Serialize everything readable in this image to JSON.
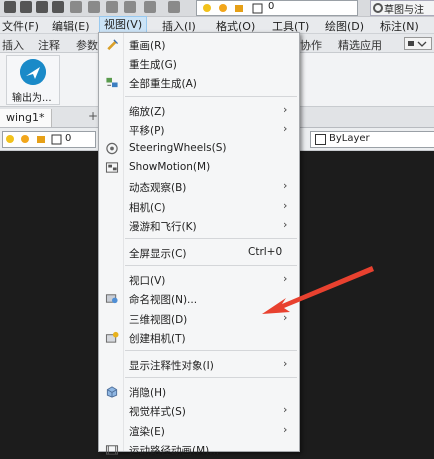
{
  "quick_access": {
    "layer_value": "0",
    "workspace_label": "草图与注"
  },
  "menubar": {
    "items": [
      "文件(F)",
      "编辑(E)",
      "视图(V)",
      "插入(I)",
      "格式(O)",
      "工具(T)",
      "绘图(D)",
      "标注(N)"
    ]
  },
  "ribbon_tabs": {
    "items": [
      "插入",
      "注释",
      "参数",
      "协作",
      "精选应用"
    ]
  },
  "ribbon": {
    "export_label": "输出为..."
  },
  "file_tabs": {
    "drawing_tab": "wing1*",
    "new_tab": "+"
  },
  "properties": {
    "layer_value": "0",
    "linetype": "ByLayer"
  },
  "view_menu": {
    "groups": [
      [
        {
          "label": "重画(R)",
          "icon": "redraw-icon",
          "submenu": false
        },
        {
          "label": "重生成(G)",
          "icon": "",
          "submenu": false
        },
        {
          "label": "全部重生成(A)",
          "icon": "regen-all-icon",
          "submenu": false
        }
      ],
      [
        {
          "label": "缩放(Z)",
          "icon": "",
          "submenu": true
        },
        {
          "label": "平移(P)",
          "icon": "",
          "submenu": true
        },
        {
          "label": "SteeringWheels(S)",
          "icon": "steering-wheel-icon",
          "submenu": false
        },
        {
          "label": "ShowMotion(M)",
          "icon": "showmotion-icon",
          "submenu": false
        },
        {
          "label": "动态观察(B)",
          "icon": "",
          "submenu": true
        },
        {
          "label": "相机(C)",
          "icon": "",
          "submenu": true
        },
        {
          "label": "漫游和飞行(K)",
          "icon": "",
          "submenu": true
        }
      ],
      [
        {
          "label": "全屏显示(C)",
          "icon": "",
          "submenu": false,
          "shortcut": "Ctrl+0"
        }
      ],
      [
        {
          "label": "视口(V)",
          "icon": "",
          "submenu": true
        },
        {
          "label": "命名视图(N)...",
          "icon": "named-views-icon",
          "submenu": false
        },
        {
          "label": "三维视图(D)",
          "icon": "",
          "submenu": true
        },
        {
          "label": "创建相机(T)",
          "icon": "create-camera-icon",
          "submenu": false
        }
      ],
      [
        {
          "label": "显示注释性对象(I)",
          "icon": "",
          "submenu": true
        }
      ],
      [
        {
          "label": "消隐(H)",
          "icon": "hide-icon",
          "submenu": false
        },
        {
          "label": "视觉样式(S)",
          "icon": "",
          "submenu": true
        },
        {
          "label": "渲染(E)",
          "icon": "",
          "submenu": true
        },
        {
          "label": "运动路径动画(M)...",
          "icon": "motion-path-icon",
          "submenu": false
        }
      ]
    ],
    "arrow_glyph": "›"
  },
  "colors": {
    "annotation_arrow": "#e8412f",
    "menu_bg": "#f5f6f7",
    "canvas_bg": "#1c1c1c"
  }
}
